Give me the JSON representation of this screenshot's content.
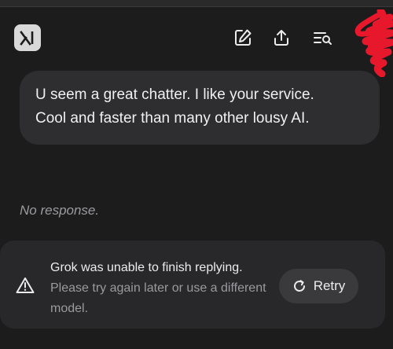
{
  "header": {
    "logo_icon": "xai-logo-icon",
    "actions": [
      {
        "icon": "edit-icon"
      },
      {
        "icon": "share-icon"
      },
      {
        "icon": "search-history-icon"
      }
    ]
  },
  "conversation": {
    "user_message": {
      "lines": [
        "U seem a great chatter. I like your service.",
        "Cool and faster than many other lousy AI."
      ]
    },
    "assistant_placeholder": "No response."
  },
  "error": {
    "icon": "warning-icon",
    "title": "Grok was unable to finish replying.",
    "message": "Please try again later or use a different model.",
    "retry_label": "Retry",
    "retry_icon": "refresh-icon"
  },
  "colors": {
    "background": "#1c1c1d",
    "bubble": "#2e2e31",
    "card": "#28282b",
    "scribble": "#e8182c"
  }
}
